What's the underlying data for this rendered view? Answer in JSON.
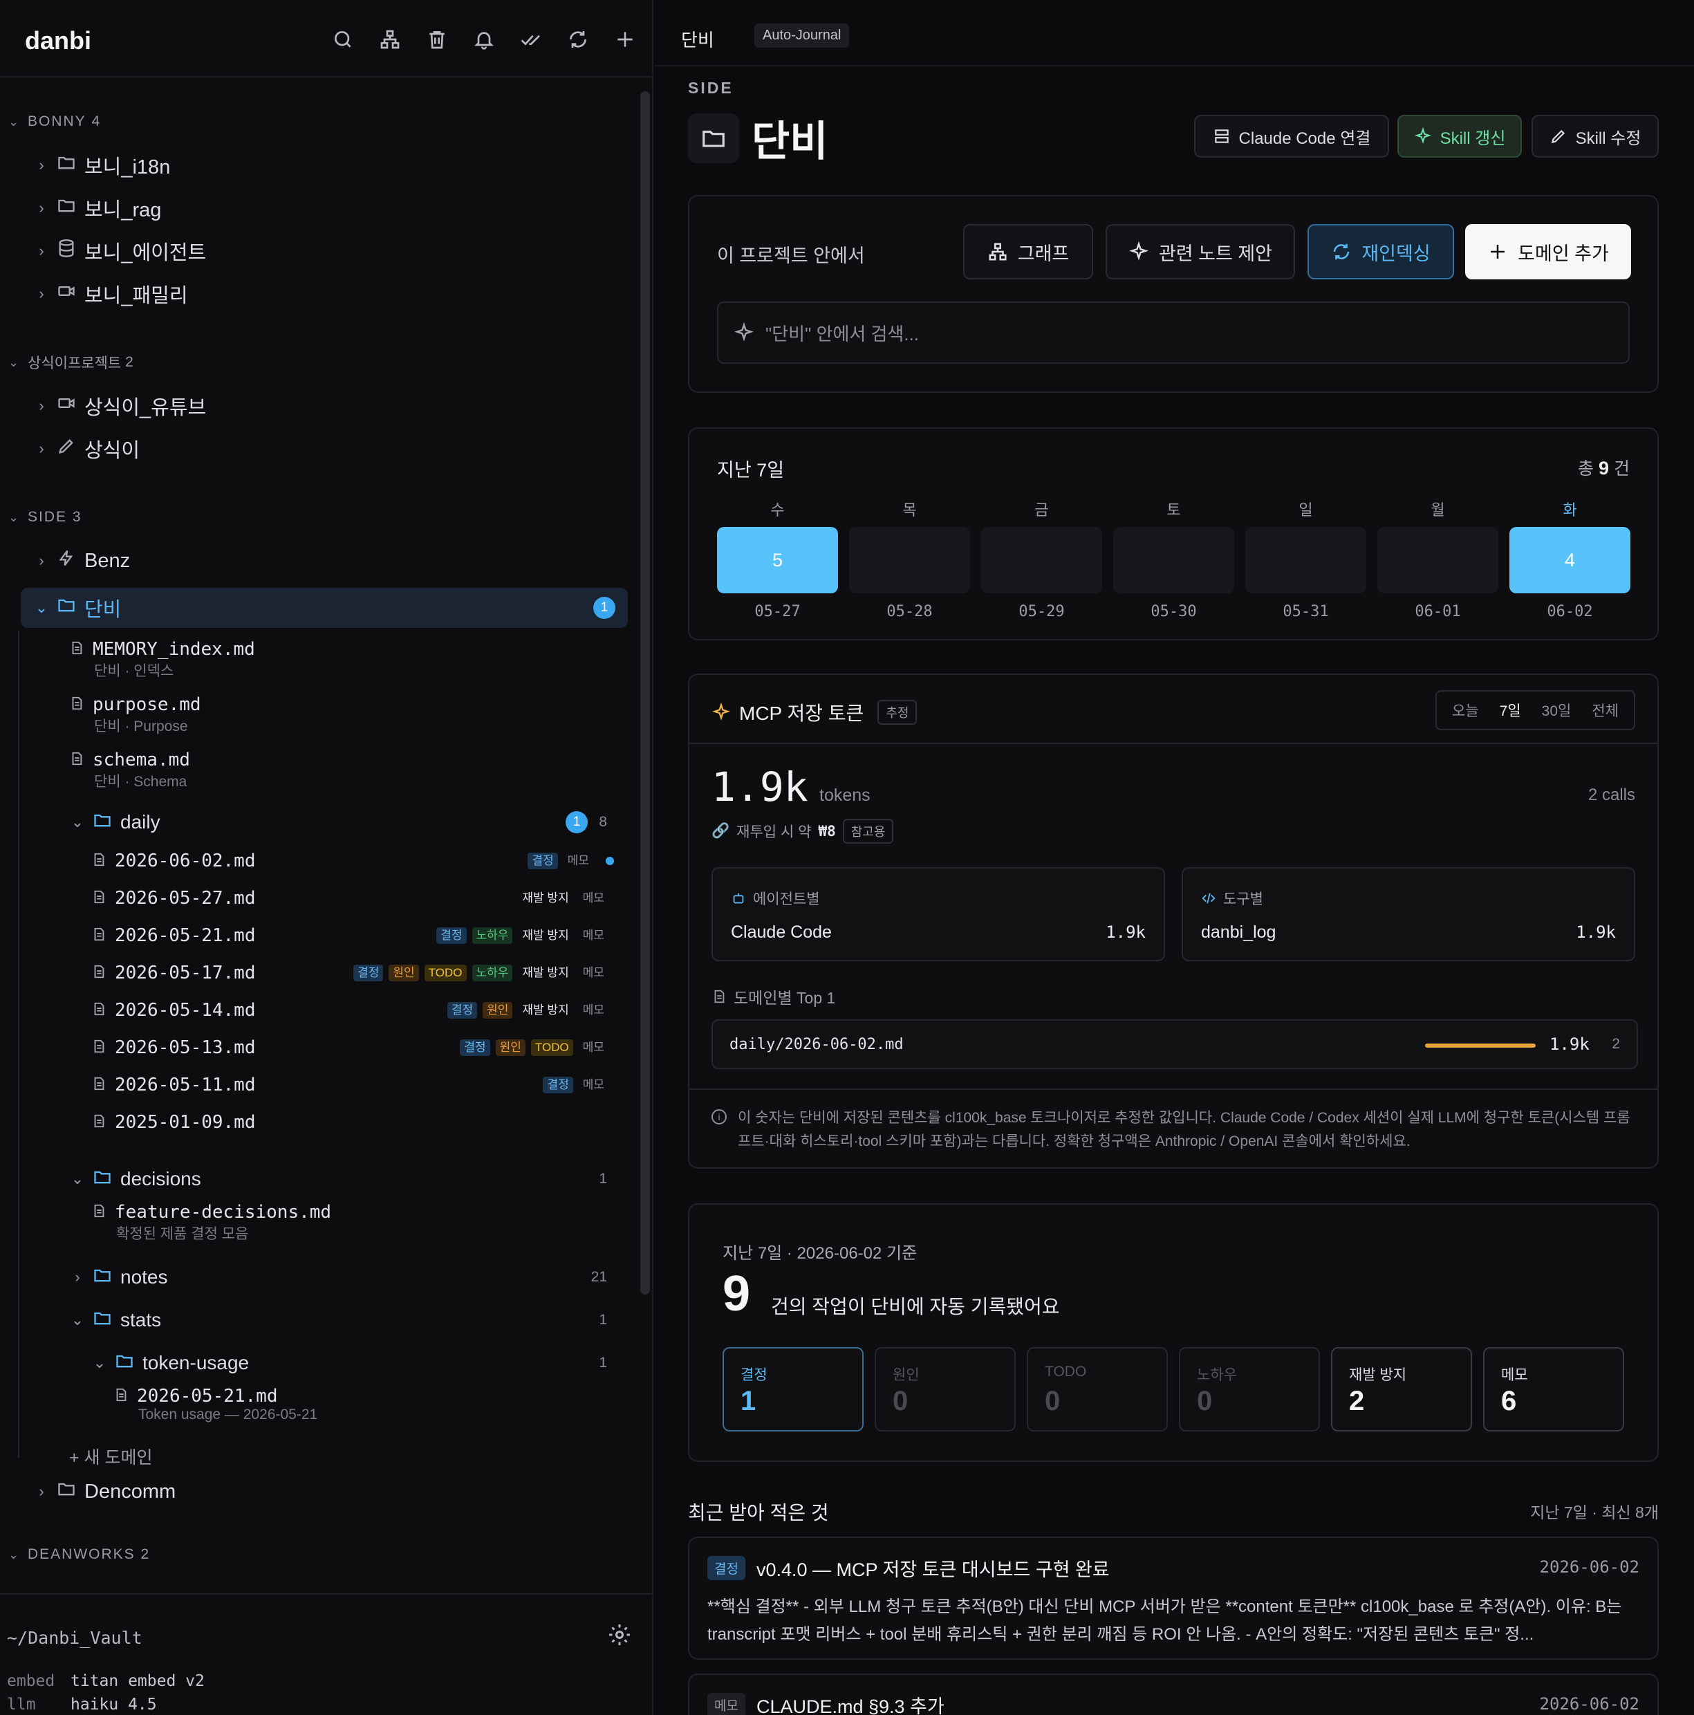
{
  "app": {
    "title": "danbi"
  },
  "sidebar": {
    "groups": [
      {
        "label": "BONNY",
        "count": "4"
      },
      {
        "label": "상식이프로젝트",
        "count": "2"
      },
      {
        "label": "SIDE",
        "count": "3"
      },
      {
        "label": "DEANWORKS",
        "count": "2"
      }
    ],
    "projects": {
      "bonny_i18n": "보니_i18n",
      "bonny_rag": "보니_rag",
      "bonny_agent": "보니_에이전트",
      "bonny_family": "보니_패밀리",
      "sangsik_youtube": "상식이_유튜브",
      "sangsik": "상식이",
      "benz": "Benz",
      "danbi": "단비",
      "dencomm": "Dencomm"
    },
    "danbi_badge": "1",
    "files": {
      "memory": {
        "name": "MEMORY_index.md",
        "sub": "단비 · 인덱스"
      },
      "purpose": {
        "name": "purpose.md",
        "sub": "단비 · Purpose"
      },
      "schema": {
        "name": "schema.md",
        "sub": "단비 · Schema"
      }
    },
    "daily": {
      "label": "daily",
      "badge": "1",
      "count": "8",
      "files": [
        {
          "name": "2026-06-02.md",
          "tags": [
            "결정",
            "메모"
          ]
        },
        {
          "name": "2026-05-27.md",
          "tags": [
            "재발 방지",
            "메모"
          ]
        },
        {
          "name": "2026-05-21.md",
          "tags": [
            "결정",
            "노하우",
            "재발 방지",
            "메모"
          ]
        },
        {
          "name": "2026-05-17.md",
          "tags": [
            "결정",
            "원인",
            "TODO",
            "노하우",
            "재발 방지",
            "메모"
          ]
        },
        {
          "name": "2026-05-14.md",
          "tags": [
            "결정",
            "원인",
            "재발 방지",
            "메모"
          ]
        },
        {
          "name": "2026-05-13.md",
          "tags": [
            "결정",
            "원인",
            "TODO",
            "메모"
          ]
        },
        {
          "name": "2026-05-11.md",
          "tags": [
            "결정",
            "메모"
          ]
        },
        {
          "name": "2025-01-09.md",
          "tags": []
        }
      ]
    },
    "decisions": {
      "label": "decisions",
      "count": "1",
      "file": "feature-decisions.md",
      "sub": "확정된 제품 결정 모음"
    },
    "notes": {
      "label": "notes",
      "count": "21"
    },
    "stats": {
      "label": "stats",
      "count": "1"
    },
    "token_usage": {
      "label": "token-usage",
      "count": "1",
      "file": "2026-05-21.md",
      "sub": "Token usage — 2026-05-21"
    },
    "new_domain": "+ 새 도메인",
    "footer": {
      "vault": "~/Danbi_Vault",
      "embed_k": "embed",
      "embed_v": "titan embed v2",
      "llm_k": "llm",
      "llm_v": "haiku 4.5"
    }
  },
  "topbar": {
    "crumb": "단비",
    "tag": "Auto-Journal"
  },
  "header": {
    "kicker": "SIDE",
    "title": "단비",
    "btn_claude": "Claude Code 연결",
    "btn_skill_refresh": "Skill 갱신",
    "btn_skill_edit": "Skill 수정"
  },
  "project_card": {
    "label": "이 프로젝트 안에서",
    "btn_graph": "그래프",
    "btn_related": "관련 노트 제안",
    "btn_reindex": "재인덱싱",
    "btn_add_domain": "도메인 추가",
    "search_placeholder": "\"단비\" 안에서 검색..."
  },
  "week": {
    "title": "지난 7일",
    "total_prefix": "총",
    "total": "9",
    "total_suffix": "건",
    "days": [
      {
        "name": "수",
        "date": "05-27",
        "value": "5"
      },
      {
        "name": "목",
        "date": "05-28",
        "value": ""
      },
      {
        "name": "금",
        "date": "05-29",
        "value": ""
      },
      {
        "name": "토",
        "date": "05-30",
        "value": ""
      },
      {
        "name": "일",
        "date": "05-31",
        "value": ""
      },
      {
        "name": "월",
        "date": "06-01",
        "value": ""
      },
      {
        "name": "화",
        "date": "06-02",
        "value": "4"
      }
    ]
  },
  "tokens": {
    "title": "MCP 저장 토큰",
    "est": "추정",
    "ranges": [
      "오늘",
      "7일",
      "30일",
      "전체"
    ],
    "selected_range": "7일",
    "total": "1.9k",
    "unit": "tokens",
    "calls": "2 calls",
    "reinput_label": "재투입 시 약",
    "reinput_value": "₩8",
    "ref": "참고용",
    "by_agent_label": "에이전트별",
    "agent_name": "Claude Code",
    "agent_value": "1.9k",
    "by_tool_label": "도구별",
    "tool_name": "danbi_log",
    "tool_value": "1.9k",
    "top_label": "도메인별 Top 1",
    "top_path": "daily/2026-06-02.md",
    "top_value": "1.9k",
    "top_count": "2",
    "note": "이 숫자는 단비에 저장된 콘텐츠를 cl100k_base 토크나이저로 추정한 값입니다. Claude Code / Codex 세션이 실제 LLM에 청구한 토큰(시스템 프롬프트·대화 히스토리·tool 스키마 포함)과는 다릅니다. 정확한 청구액은 Anthropic / OpenAI 콘솔에서 확인하세요."
  },
  "journal": {
    "sub": "지난 7일 · 2026-06-02 기준",
    "count": "9",
    "text": "건의 작업이 단비에 자동 기록됐어요",
    "stats": [
      {
        "label": "결정",
        "value": "1"
      },
      {
        "label": "원인",
        "value": "0"
      },
      {
        "label": "TODO",
        "value": "0"
      },
      {
        "label": "노하우",
        "value": "0"
      },
      {
        "label": "재발 방지",
        "value": "2"
      },
      {
        "label": "메모",
        "value": "6"
      }
    ]
  },
  "recent": {
    "title": "최근 받아 적은 것",
    "meta": "지난 7일 · 최신 8개",
    "entries": [
      {
        "tag": "결정",
        "title": "v0.4.0 — MCP 저장 토큰 대시보드 구현 완료",
        "date": "2026-06-02",
        "body": "**핵심 결정** - 외부 LLM 청구 토큰 추적(B안) 대신 단비 MCP 서버가 받은 **content 토큰만** cl100k_base 로 추정(A안). 이유: B는 transcript 포맷 리버스 + tool 분배 휴리스틱 + 권한 분리 깨짐 등 ROI 안 나옴. - A안의 정확도: \"저장된 콘텐츠 토큰\" 정..."
      },
      {
        "tag": "메모",
        "title": "CLAUDE.md §9.3 추가",
        "date": "2026-06-02",
        "body": ""
      }
    ]
  },
  "colors": {
    "accent": "#58c3fb",
    "green": "#6fe0a2",
    "orange": "#e8a23a"
  }
}
